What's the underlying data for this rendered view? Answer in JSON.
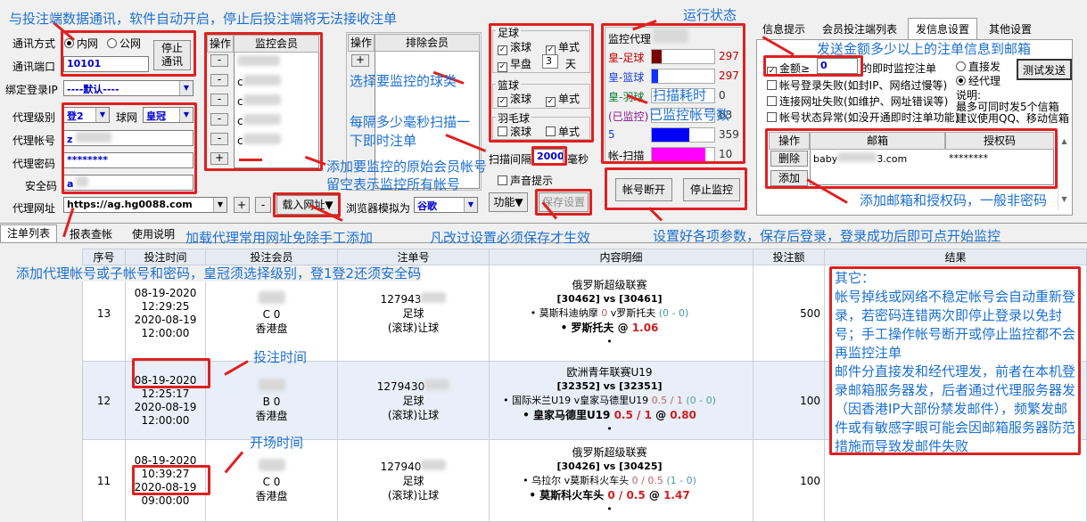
{
  "conn": {
    "mode_label": "通讯方式",
    "opt_lan": "内网",
    "opt_wan": "公网",
    "port_label": "通讯端口",
    "port": "10101",
    "stop_btn": "停止\n通讯",
    "bind_ip_label": "绑定登录IP",
    "bind_ip": "----默认----"
  },
  "agent": {
    "level_label": "代理级别",
    "level": "登2",
    "net_label": "球网",
    "net": "皇冠",
    "account_label": "代理帐号",
    "account": "z",
    "password_label": "代理密码",
    "password": "********",
    "code_label": "安全码",
    "code": "a",
    "url_label": "代理网址",
    "url": "https://ag.hg0088.com",
    "plus": "+",
    "minus": "-",
    "load_url": "载入网址▼",
    "browser_label": "浏览器模拟为",
    "browser": "谷歌"
  },
  "monitor_members": {
    "col_op": "操作",
    "col_name": "监控会员",
    "rows": [
      "c",
      "c",
      "c",
      "c",
      "c"
    ],
    "minus": "-",
    "plus": "+"
  },
  "exclude_members": {
    "col_op": "操作",
    "col_name": "排除会员",
    "plus": "+"
  },
  "ball_types": {
    "football": "足球",
    "basketball": "篮球",
    "badminton": "羽毛球",
    "live": "滚球",
    "single": "单式",
    "early": "早盘",
    "days": "3",
    "days_unit": "天"
  },
  "scan": {
    "label": "扫描间隔",
    "value": "2000",
    "unit": "毫秒",
    "sound": "声音提示",
    "func": "功能▼",
    "save": "保存设置"
  },
  "status": {
    "title": "监控代理",
    "rows": [
      {
        "label": "皇-足球",
        "value": "297",
        "color": "#c00000"
      },
      {
        "label": "皇-篮球",
        "value": "297",
        "color": "#1a3fd6"
      },
      {
        "label": "皇-羽球",
        "value": "0",
        "color": "#0a7a30"
      },
      {
        "label": "(已监控)",
        "value": "63",
        "color": "#8b1a8b"
      },
      {
        "label": "5",
        "value": "359",
        "color": "#1a3fd6"
      },
      {
        "label": "帐-扫描",
        "value": "10",
        "color": "#000"
      }
    ],
    "bars": [
      {
        "color": "#7a0000",
        "fill": 0.15
      },
      {
        "color": "#1030ff",
        "fill": 0.1
      },
      {
        "color": "#ffffff",
        "fill": 0
      },
      {
        "color": "#ffffff",
        "fill": 0
      },
      {
        "color": "#0000ff",
        "fill": 0.6
      },
      {
        "color": "#ff00ff",
        "fill": 0.85
      }
    ],
    "btn_disconnect": "帐号断开",
    "btn_stop": "停止监控"
  },
  "tabs_right": [
    "信息提示",
    "会员投注端列表",
    "发信息设置",
    "其他设置"
  ],
  "mail": {
    "amount_label": "金额≥",
    "amount": "0",
    "amount_suffix": "的即时监控注单",
    "direct": "直接发",
    "via_agent": "经代理",
    "opt_login_fail": "帐号登录失败(如封IP、网络过慢等)",
    "opt_net_fail": "连接网址失败(如维护、网址错误等)",
    "opt_status": "帐号状态异常(如没开通即时注单功能)",
    "test_btn": "测试发送",
    "hint1": "说明:",
    "hint2": "最多可同时发5个信箱",
    "hint3": "建议使用QQ、移动信箱",
    "col_op": "操作",
    "col_mail": "邮箱",
    "col_code": "授权码",
    "del": "删除",
    "add": "添加",
    "mail_value": "baby",
    "mail_tail": "3.com",
    "code_value": "********"
  },
  "tabs_bottom": [
    "注单列表",
    "报表查帐",
    "使用说明"
  ],
  "table": {
    "headers": [
      "序号",
      "投注时间",
      "投注会员",
      "注单号",
      "内容明细",
      "投注额",
      "结果"
    ],
    "rows": [
      {
        "no": "13",
        "time1": "08-19-2020",
        "time2": "12:29:25",
        "time3": "2020-08-19",
        "time4": "12:00:00",
        "member1": "C 0",
        "member2": "香港盘",
        "order1": "127943",
        "order2": "足球",
        "order3": "(滚球)让球",
        "league": "俄罗斯超级联赛",
        "teams": "[30462] vs [30461]",
        "bet1": "莫斯科迪纳摩",
        "bet1b": "v罗斯托夫",
        "score1": "(0 - 0)",
        "bet2": "罗斯托夫",
        "odds": "1.06",
        "amount": "500"
      },
      {
        "no": "12",
        "time1": "08-19-2020",
        "time2": "12:25:17",
        "time3": "2020-08-19",
        "time4": "12:00:00",
        "member1": "B 0",
        "member2": "香港盘",
        "order1": "1279430",
        "order2": "足球",
        "order3": "(滚球)让球",
        "league": "欧洲青年联赛U19",
        "teams": "[32352] vs [32351]",
        "bet1": "国际米兰U19 v皇家马德里U19",
        "hcp": "0.5 / 1",
        "score1": "(0 - 0)",
        "bet2": "皇家马德里U19",
        "hcp2": "0.5 / 1",
        "odds": "0.80",
        "amount": "100"
      },
      {
        "no": "11",
        "time1": "08-19-2020",
        "time2": "10:39:27",
        "time3": "2020-08-19",
        "time4": "09:00:00",
        "member1": "C 0",
        "member2": "香港盘",
        "order1": "127940",
        "order2": "足球",
        "order3": "(滚球)让球",
        "league": "俄罗斯超级联赛",
        "teams": "[30426] vs [30425]",
        "bet1": "乌拉尔 v莫斯科火车头",
        "hcp": "0 / 0.5",
        "score1": "(1 - 0)",
        "bet2": "莫斯科火车头",
        "hcp2": "0 / 0.5",
        "odds": "1.47",
        "amount": "100"
      }
    ]
  },
  "notes": {
    "n1": "与投注端数据通讯，软件自动开启，停止后投注端将无法接收注单",
    "n2": "运行状态",
    "n3": "发送金额多少以上的注单信息到邮箱",
    "n4": "选择要监控的球类",
    "n5": "扫描耗时",
    "n6": "已监控帐号数",
    "n7": "每隔多少毫秒扫描一",
    "n7b": "下即时注单",
    "n8": "添加要监控的原始会员帐号",
    "n8b": "留空表示监控所有帐号",
    "n9": "添加邮箱和授权码，一般非密码",
    "n10": "加载代理常用网址免除手工添加",
    "n11": "凡改过设置必须保存才生效",
    "n12": "设置好各项参数，保存后登录，登录成功后即可点开始监控",
    "n13": "添加代理帐号或子帐号和密码，皇冠须选择级别，登1登2还须安全码",
    "n14": "投注时间",
    "n15": "开场时间",
    "other": [
      "其它：",
      "帐号掉线或网络不稳定帐号会自动重新登录，若密码连错两次即停止登录以免封号；手工操作帐号断开或停止监控都不会再监控注单",
      "邮件分直接发和经代理发，前者在本机登录邮箱服务器发，后者通过代理服务器发（因香港IP大部份禁发邮件），频繁发邮件或有敏感字眼可能会因邮箱服务器防范措施而导致发邮件失败"
    ]
  }
}
